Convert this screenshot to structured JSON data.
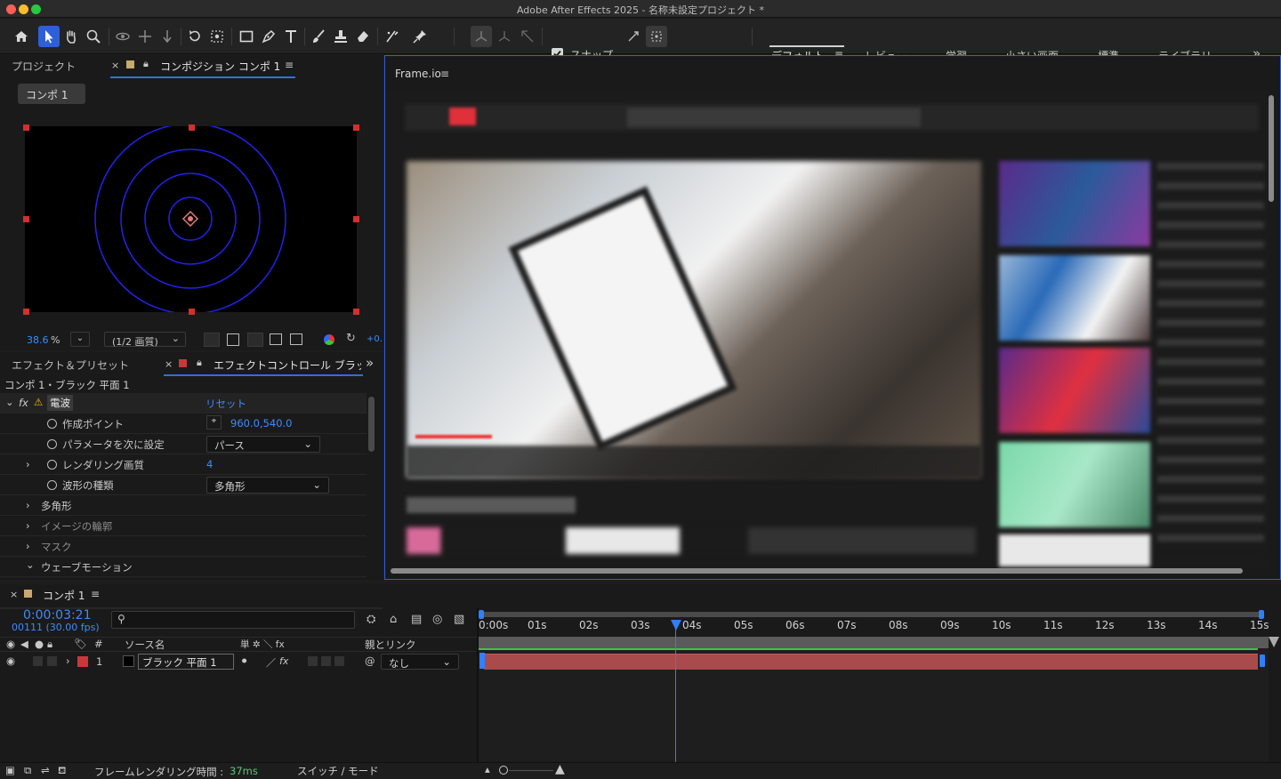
{
  "window": {
    "title": "Adobe After Effects 2025 - 名称未設定プロジェクト *"
  },
  "colors": {
    "accent": "#2f6fe0",
    "blue_text": "#3d8bff",
    "layer_red": "#c8383a",
    "layer_bar": "#a94a4c",
    "traffic_red": "#ff5f57",
    "traffic_yellow": "#febc2e",
    "traffic_green": "#28c840"
  },
  "toolbar": {
    "tools": [
      "home-icon",
      "selection-tool-icon",
      "hand-tool-icon",
      "zoom-tool-icon",
      "orbit-camera-icon",
      "pan-camera-icon",
      "dolly-camera-icon",
      "rotate-tool-icon",
      "pan-behind-icon",
      "rectangle-tool-icon",
      "pen-tool-icon",
      "type-tool-icon",
      "brush-tool-icon",
      "clone-stamp-icon",
      "eraser-tool-icon",
      "roto-brush-icon",
      "puppet-pin-icon"
    ],
    "snap_label": "スナップ",
    "workspaces": [
      "デフォルト",
      "レビュー",
      "学習",
      "小さい画面",
      "標準",
      "ライブラリ"
    ],
    "more": "»"
  },
  "project_panel": {
    "tab_project": "プロジェクト",
    "tab_close": "×",
    "tab_composition": "コンポジション コンポ 1",
    "menu": "≡",
    "comp_button": "コンポ 1",
    "zoom_value": "38.6",
    "zoom_unit": "%",
    "resolution": "(1/2 画質)",
    "exposure": "+0."
  },
  "effects_panel": {
    "tab_effects": "エフェクト＆プリセット",
    "tab_close": "×",
    "tab_effect_controls": "エフェクトコントロール ブラッ",
    "more": "»",
    "layer_path": "コンポ 1・ブラック 平面 1",
    "effect_name": "電波",
    "fx": "fx",
    "reset": "リセット",
    "rows": [
      {
        "label": "作成ポイント",
        "value": "960.0,540.0"
      },
      {
        "label": "パラメータを次に設定",
        "value": "パース"
      },
      {
        "label": "レンダリング画質",
        "value": "4"
      },
      {
        "label": "波形の種類",
        "value": "多角形"
      }
    ],
    "groups": [
      {
        "label": "多角形",
        "dim": false
      },
      {
        "label": "イメージの輪郭",
        "dim": true
      },
      {
        "label": "マスク",
        "dim": true
      },
      {
        "label": "ウェーブモーション",
        "dim": false
      }
    ]
  },
  "frameio_panel": {
    "title": "Frame.io",
    "menu": "≡"
  },
  "timeline": {
    "tab_close": "×",
    "comp_name": "コンポ 1",
    "menu": "≡",
    "timecode": "0:00:03:21",
    "frame_info": "00111 (30.00 fps)",
    "search_placeholder": "",
    "columns": {
      "num": "#",
      "source_name": "ソース名",
      "switches": "単 ✲ ＼ fx",
      "parent": "親とリンク"
    },
    "ticks": [
      "0:00s",
      "01s",
      "02s",
      "03s",
      "04s",
      "05s",
      "06s",
      "07s",
      "08s",
      "09s",
      "10s",
      "11s",
      "12s",
      "13s",
      "14s",
      "15s"
    ],
    "playhead_seconds": 3.7,
    "layers": [
      {
        "index": "1",
        "name": "ブラック 平面 1",
        "parent": "なし"
      }
    ]
  },
  "statusbar": {
    "render_label": "フレームレンダリング時間 :",
    "render_value": "37ms",
    "switch_mode": "スイッチ / モード"
  }
}
